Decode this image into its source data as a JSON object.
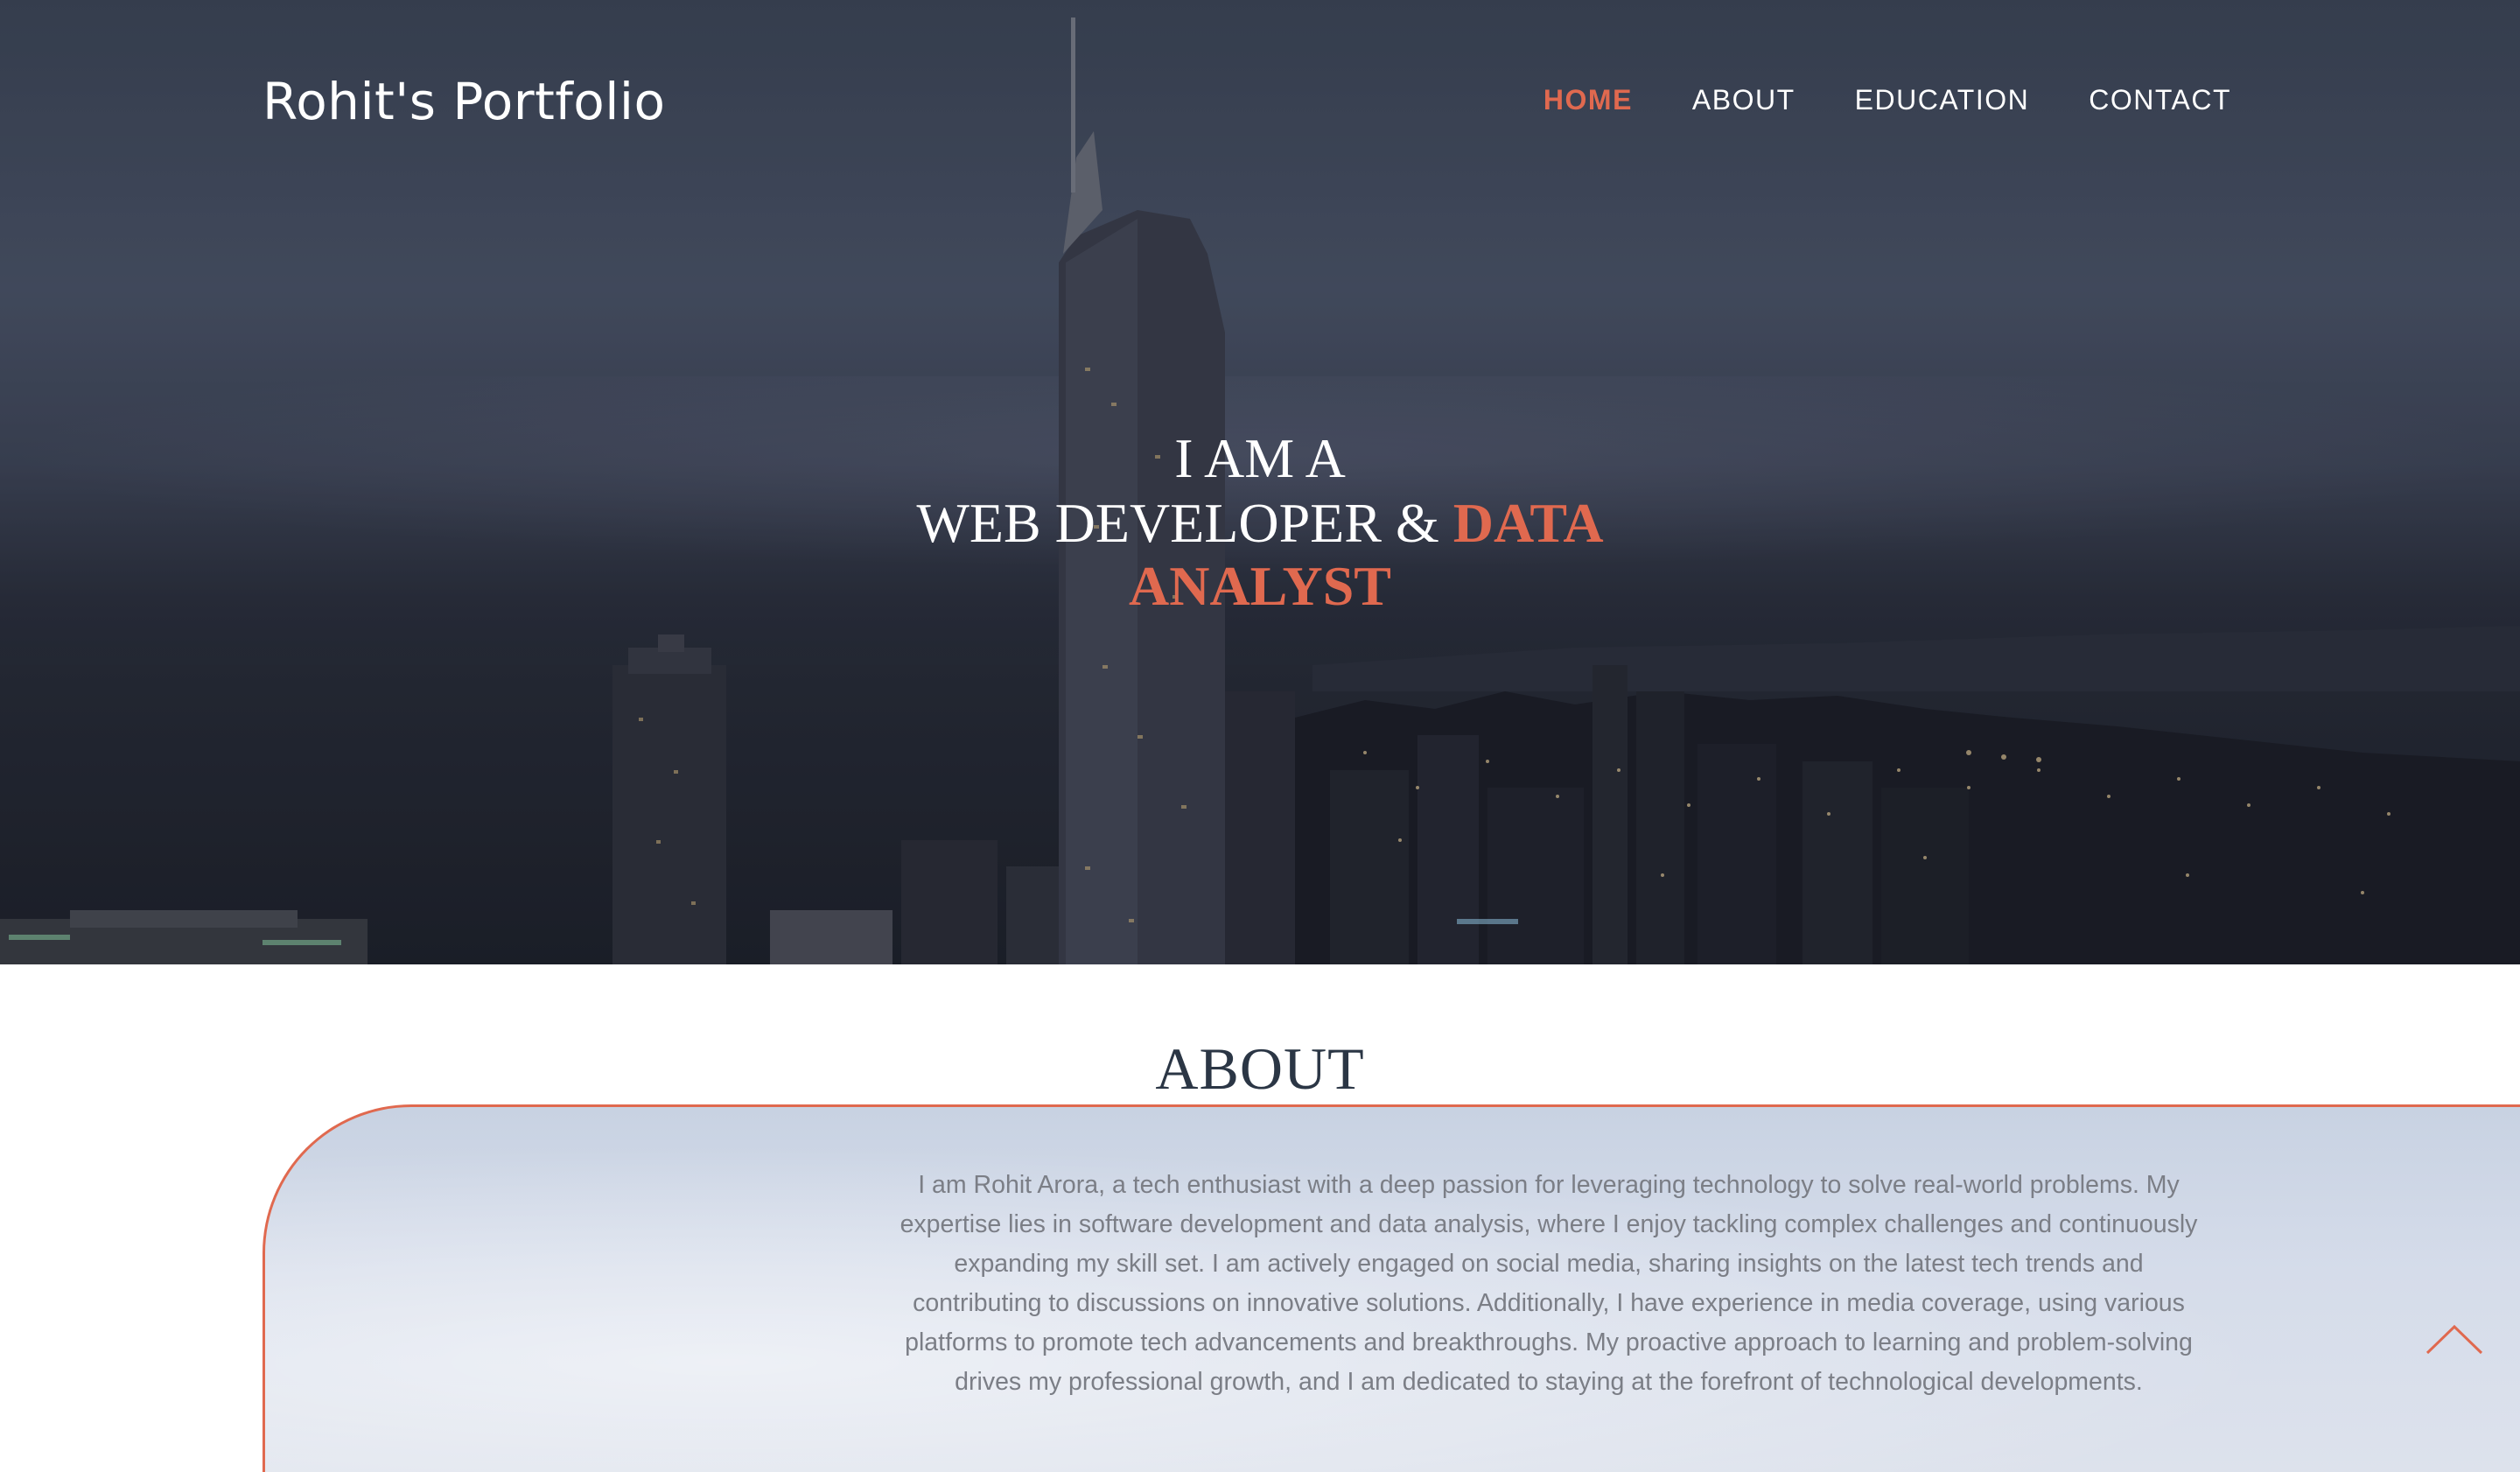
{
  "brand": {
    "title": "Rohit's Portfolio"
  },
  "nav": {
    "items": [
      {
        "label": "HOME",
        "active": true
      },
      {
        "label": "ABOUT",
        "active": false
      },
      {
        "label": "EDUCATION",
        "active": false
      },
      {
        "label": "CONTACT",
        "active": false
      }
    ]
  },
  "hero": {
    "line1": "I AM A",
    "line2_prefix": "WEB DEVELOPER & ",
    "line2_accent": "DATA ANALYST"
  },
  "about": {
    "title": "ABOUT",
    "text": "I am Rohit Arora, a tech enthusiast with a deep passion for leveraging technology to solve real-world problems. My expertise lies in software development and data analysis, where I enjoy tackling complex challenges and continuously expanding my skill set. I am actively engaged on social media, sharing insights on the latest tech trends and contributing to discussions on innovative solutions. Additionally, I have experience in media coverage, using various platforms to promote tech advancements and breakthroughs. My proactive approach to learning and problem-solving drives my professional growth, and I am dedicated to staying at the forefront of technological developments."
  },
  "icons": {
    "scroll_top": "chevron-up-icon"
  },
  "colors": {
    "accent": "#e0694f",
    "heading": "#2b3645",
    "body_text": "#7b7e86"
  }
}
